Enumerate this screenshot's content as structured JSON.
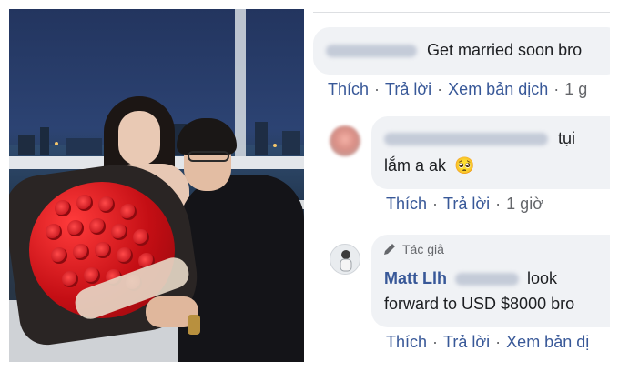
{
  "comments": [
    {
      "text": "Get married soon bro",
      "actions": {
        "like": "Thích",
        "reply": "Trả lời",
        "translate": "Xem bản dịch",
        "time": "1 g"
      }
    },
    {
      "text_line1": "tụi",
      "text_line2": "lắm a ak",
      "emoji": "🥺",
      "actions": {
        "like": "Thích",
        "reply": "Trả lời",
        "time": "1 giờ"
      }
    },
    {
      "badge": "Tác giả",
      "author": "Matt Llh",
      "text_line1": "look",
      "text_line2": "forward to USD $8000 bro",
      "actions": {
        "like": "Thích",
        "reply": "Trả lời",
        "translate": "Xem bản dị"
      }
    }
  ],
  "colors": {
    "link": "#385898",
    "bubble": "#f0f2f5",
    "meta": "#65676b"
  }
}
